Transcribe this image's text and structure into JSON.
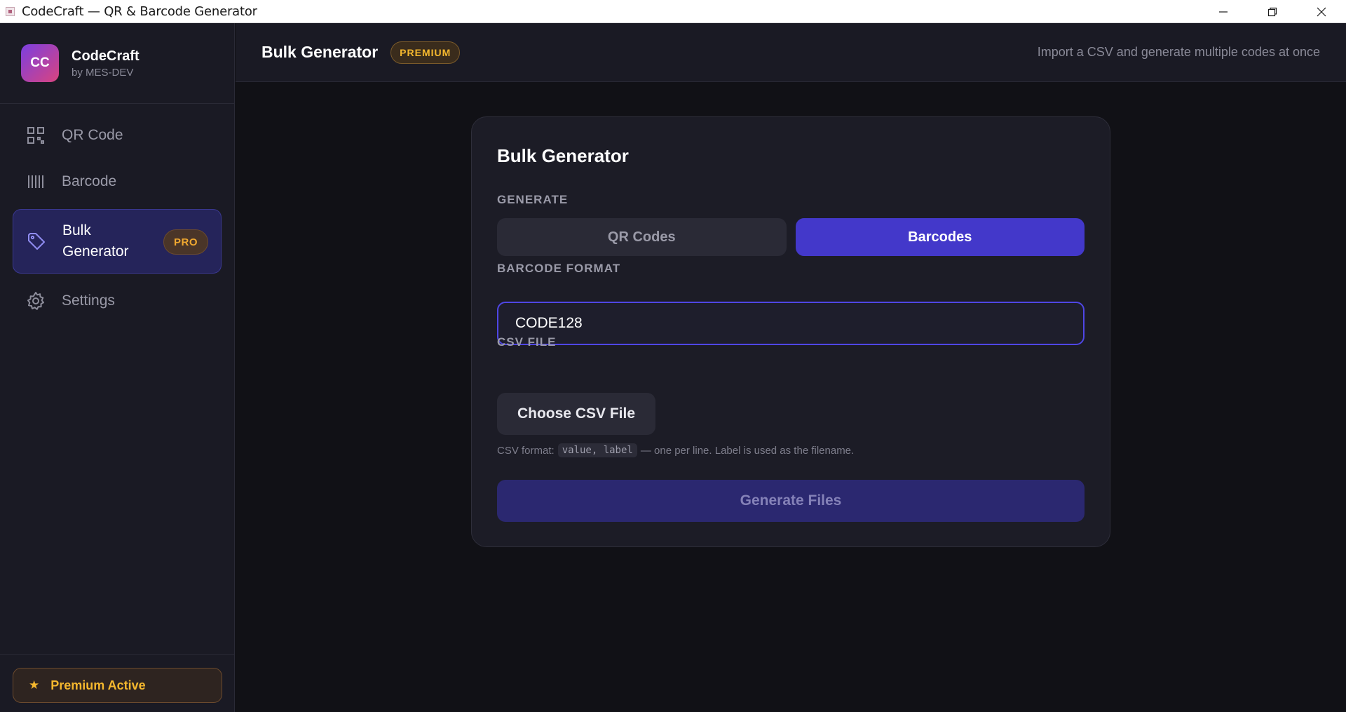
{
  "window": {
    "title": "CodeCraft — QR & Barcode Generator"
  },
  "brand": {
    "initials": "CC",
    "name": "CodeCraft",
    "subtitle": "by MES-DEV"
  },
  "sidebar": {
    "items": [
      {
        "label": "QR Code",
        "icon": "qr-code-icon"
      },
      {
        "label": "Barcode",
        "icon": "barcode-icon"
      },
      {
        "label": "Bulk Generator",
        "icon": "tag-icon",
        "badge": "PRO",
        "active": true
      },
      {
        "label": "Settings",
        "icon": "gear-icon"
      }
    ],
    "footer": {
      "star": "★",
      "label": "Premium Active"
    }
  },
  "header": {
    "title": "Bulk Generator",
    "badge": "PREMIUM",
    "subtitle": "Import a CSV and generate multiple codes at once"
  },
  "card": {
    "title": "Bulk Generator",
    "generate_label": "GENERATE",
    "options": [
      "QR Codes",
      "Barcodes"
    ],
    "selected_option": "Barcodes",
    "format_label": "BARCODE FORMAT",
    "format_value": "CODE128",
    "csv_label": "CSV FILE",
    "csv_button": "Choose CSV File",
    "hint_prefix": "CSV format:",
    "hint_code": "value, label",
    "hint_suffix": "— one per line. Label is used as the filename.",
    "submit_label": "Generate Files"
  },
  "colors": {
    "accent": "#4338ca",
    "premium": "#f5b82e",
    "background": "#111116",
    "sidebar": "#1a1a24"
  }
}
